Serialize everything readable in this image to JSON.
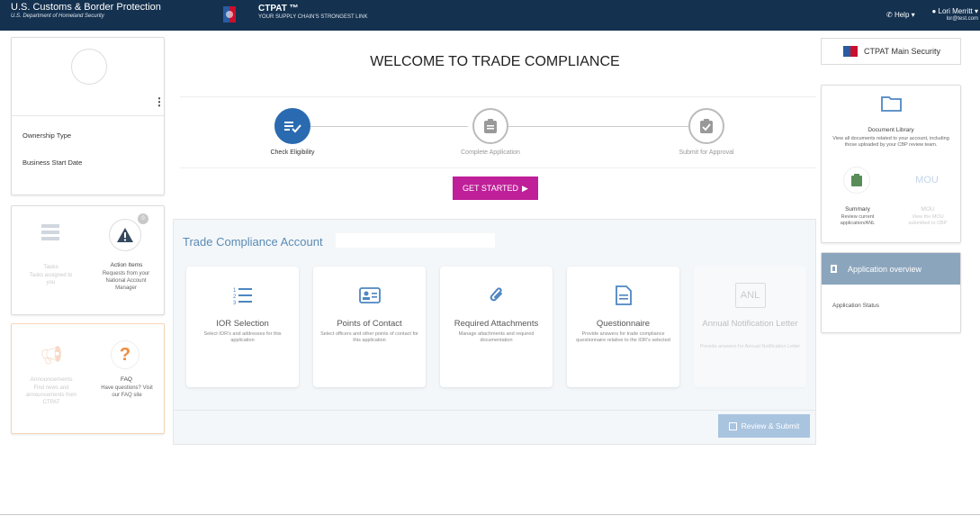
{
  "header": {
    "agency_name": "U.S. Customs & Border Protection",
    "agency_dept": "U.S. Department of Homeland Security",
    "program_name": "CTPAT ™",
    "program_tagline": "YOUR SUPPLY CHAIN'S STRONGEST LINK",
    "help_label": "Help ▾",
    "user_name": "Lori Merritt ▾",
    "user_email": "lor@test.com"
  },
  "profile_card": {
    "more_icon": "⋮",
    "ownership_label": "Ownership Type",
    "start_date_label": "Business Start Date"
  },
  "tasks_card": {
    "tasks_title": "Tasks",
    "tasks_desc": "Tasks assigned to you",
    "action_title": "Action Items",
    "action_desc": "Requests from your National Account Manager",
    "action_badge": "0"
  },
  "info_card": {
    "ann_title": "Announcements",
    "ann_desc": "Find news and announcements from CTPAT",
    "faq_title": "FAQ",
    "faq_desc": "Have questions? Visit our FAQ site"
  },
  "main": {
    "welcome_title": "WELCOME TO TRADE COMPLIANCE",
    "steps": [
      {
        "label": "Check Eligibility",
        "active": true
      },
      {
        "label": "Complete Application",
        "active": false
      },
      {
        "label": "Submit for Approval",
        "active": false
      }
    ],
    "get_started_label": "GET STARTED",
    "account_title": "Trade Compliance Account",
    "tiles": [
      {
        "title": "IOR Selection",
        "desc": "Select IOR's and addresses for this application",
        "icon": "list-icon"
      },
      {
        "title": "Points of Contact",
        "desc": "Select officers and other points of contact for this application",
        "icon": "contact-card-icon"
      },
      {
        "title": "Required Attachments",
        "desc": "Manage attachments and required documentation",
        "icon": "paperclip-icon"
      },
      {
        "title": "Questionnaire",
        "desc": "Provide answers for trade compliance questionnaire relative to the IOR's selected",
        "icon": "document-icon"
      },
      {
        "title": "Annual Notification Letter",
        "desc": "Provide answers for Annual Notification Letter",
        "icon": "anl-icon",
        "icon_text": "ANL"
      }
    ],
    "review_submit_label": "Review & Submit"
  },
  "right": {
    "main_security_label": "CTPAT Main Security",
    "doc_library_title": "Document Library",
    "doc_library_desc": "View all documents related to your account, including those uploaded by your CBP review team.",
    "summary_title": "Summary",
    "summary_desc": "Review current application/ANL",
    "mou_icon_text": "MOU",
    "mou_title": "MOU",
    "mou_desc": "View the MOU submitted to CBP",
    "overview_title": "Application overview",
    "status_label": "Application Status"
  },
  "colors": {
    "topbar": "#14314f",
    "accent_blue": "#2a6ab0",
    "get_started": "#bf1f99",
    "overview_header": "#8ba5bd",
    "info_card_border": "#f5d5b5"
  }
}
